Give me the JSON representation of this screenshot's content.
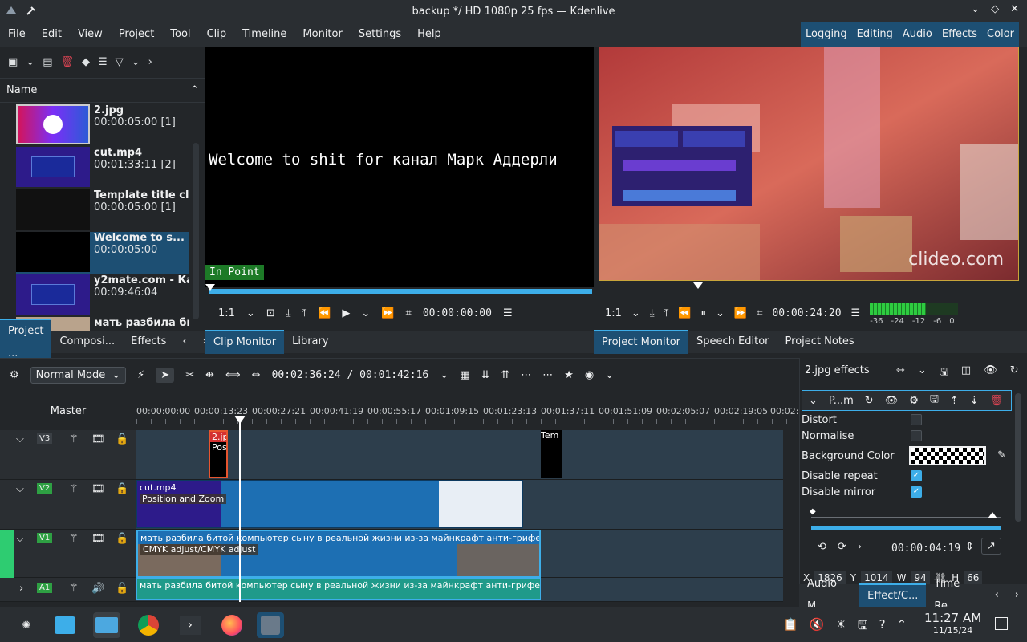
{
  "window": {
    "title": "backup */ HD 1080p 25 fps — Kdenlive"
  },
  "menu": [
    "File",
    "Edit",
    "View",
    "Project",
    "Tool",
    "Clip",
    "Timeline",
    "Monitor",
    "Settings",
    "Help"
  ],
  "layouts": [
    "Logging",
    "Editing",
    "Audio",
    "Effects",
    "Color"
  ],
  "bin": {
    "header": "Name",
    "clips": [
      {
        "name": "2.jpg",
        "duration": "00:00:05:00 [1]"
      },
      {
        "name": "cut.mp4",
        "duration": "00:01:33:11 [2]"
      },
      {
        "name": "Template title clip",
        "duration": "00:00:05:00 [1]"
      },
      {
        "name": "Welcome to s...",
        "duration": "00:00:05:00"
      },
      {
        "name": "y2mate.com - Как",
        "duration": "00:09:46:04"
      },
      {
        "name": "мать разбила бит",
        "duration": ""
      }
    ],
    "tabs": [
      "Project ...",
      "Composi...",
      "Effects"
    ]
  },
  "clip_monitor": {
    "text": "Welcome to shit for  канал Марк Аддерли",
    "in_point": "In Point",
    "zoom": "1:1",
    "timecode": "00:00:00:00",
    "tabs": [
      "Clip Monitor",
      "Library"
    ]
  },
  "project_monitor": {
    "watermark": "clideo.com",
    "zoom": "1:1",
    "timecode": "00:00:24:20",
    "meter_labels": [
      "-36",
      "-24",
      "-12",
      "-6",
      "0"
    ],
    "tabs": [
      "Project Monitor",
      "Speech Editor",
      "Project Notes"
    ]
  },
  "timeline": {
    "mode": "Normal Mode",
    "timecode": "00:02:36:24 / 00:01:42:16",
    "master": "Master",
    "ruler": [
      "00:00:00:00",
      "00:00:13:23",
      "00:00:27:21",
      "00:00:41:19",
      "00:00:55:17",
      "00:01:09:15",
      "00:01:23:13",
      "00:01:37:11",
      "00:01:51:09",
      "00:02:05:07",
      "00:02:19:05",
      "00:02:3"
    ],
    "tracks": [
      "V3",
      "V2",
      "V1",
      "A1"
    ],
    "clips": {
      "v3_a": "2.jpg",
      "v3_a_effect": "Posi",
      "v3_b": "Tem",
      "v2_name": "cut.mp4",
      "v2_effect": "Position and Zoom",
      "v1_name": "мать разбила битой компьютер сыну в реальной жизни из-за майнкрафт анти-грифер шоу #...",
      "v1_effect": "CMYK adjust/CMYK adjust",
      "a1_name": "мать разбила битой компьютер сыну в реальной жизни из-за майнкрафт анти-грифер шоу #..."
    }
  },
  "effects_panel": {
    "title": "2.jpg effects",
    "effect_name": "P...m",
    "params": [
      {
        "label": "Distort",
        "checked": false
      },
      {
        "label": "Normalise",
        "checked": false
      },
      {
        "label": "Background Color",
        "checked": null
      },
      {
        "label": "Disable repeat",
        "checked": true
      },
      {
        "label": "Disable mirror",
        "checked": true
      }
    ],
    "keyframe_time": "00:00:04:19",
    "geometry": {
      "x_label": "X",
      "x": "1826",
      "y_label": "Y",
      "y": "1014",
      "w_label": "W",
      "w": "94",
      "h_label": "H",
      "h": "66"
    },
    "tabs": [
      "Audio M...",
      "Effect/C...",
      "Time Re..."
    ]
  },
  "taskbar": {
    "time": "11:27 AM",
    "date": "11/15/24"
  }
}
